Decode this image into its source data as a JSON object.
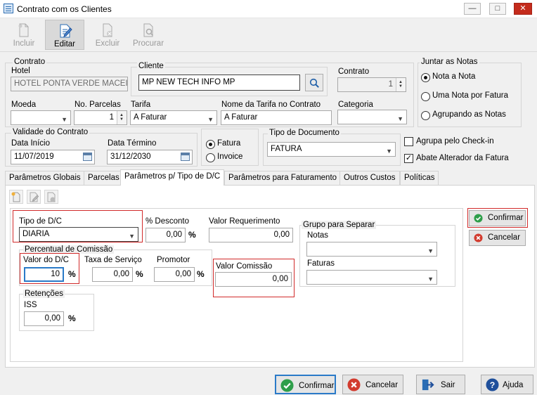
{
  "window": {
    "title": "Contrato com os Clientes",
    "minimize": "—",
    "maximize": "□",
    "close": "✕"
  },
  "toolbar": {
    "incluir": "Incluir",
    "editar": "Editar",
    "excluir": "Excluir",
    "procurar": "Procurar"
  },
  "contrato": {
    "legend": "Contrato",
    "hotel_label": "Hotel",
    "hotel_value": "HOTEL PONTA VERDE MACEIÓ",
    "cliente_legend": "Cliente",
    "cliente_value": "MP NEW TECH INFO MP",
    "contrato_label": "Contrato",
    "contrato_value": "1",
    "moeda_label": "Moeda",
    "moeda_value": "",
    "parcelas_label": "No. Parcelas",
    "parcelas_value": "1",
    "tarifa_label": "Tarifa",
    "tarifa_value": "A Faturar",
    "nome_tarifa_label": "Nome da Tarifa no Contrato",
    "nome_tarifa_value": "A Faturar",
    "categoria_label": "Categoria",
    "categoria_value": ""
  },
  "juntar": {
    "legend": "Juntar as Notas",
    "options": [
      "Nota a Nota",
      "Uma Nota por Fatura",
      "Agrupando as Notas"
    ],
    "selected": 0
  },
  "validade": {
    "legend": "Validade do Contrato",
    "inicio_label": "Data Início",
    "inicio_value": "11/07/2019",
    "termino_label": "Data Término",
    "termino_value": "31/12/2030"
  },
  "fatura_radio": {
    "fatura": "Fatura",
    "invoice": "Invoice",
    "selected": "fatura"
  },
  "tipo_documento": {
    "legend": "Tipo de Documento",
    "value": "FATURA"
  },
  "checks": {
    "agrupa_label": "Agrupa pelo Check-in",
    "agrupa_checked": false,
    "abate_label": "Abate Alterador da Fatura",
    "abate_checked": true,
    "check_mark": "✓"
  },
  "tabs": [
    {
      "label": "Parâmetros Globais"
    },
    {
      "label": "Parcelas"
    },
    {
      "label": "Parâmetros p/ Tipo de D/C"
    },
    {
      "label": "Parâmetros para Faturamento"
    },
    {
      "label": "Outros Custos"
    },
    {
      "label": "Políticas"
    }
  ],
  "selected_tab": 2,
  "dc": {
    "tipo_label": "Tipo de D/C",
    "tipo_value": "DIARIA",
    "desconto_label": "% Desconto",
    "desconto_value": "0,00",
    "valor_req_label": "Valor Requerimento",
    "valor_req_value": "0,00",
    "comissao_legend": "Percentual de Comissão",
    "valor_dc_label": "Valor do D/C",
    "valor_dc_value": "10",
    "taxa_label": "Taxa de Serviço",
    "taxa_value": "0,00",
    "promotor_label": "Promotor",
    "promotor_value": "0,00",
    "valor_comissao_label": "Valor Comissão",
    "valor_comissao_value": "0,00",
    "retencoes_legend": "Retenções",
    "iss_label": "ISS",
    "iss_value": "0,00",
    "pct": "%"
  },
  "grupo": {
    "legend": "Grupo para Separar",
    "notas_label": "Notas",
    "notas_value": "",
    "faturas_label": "Faturas",
    "faturas_value": ""
  },
  "side_buttons": {
    "confirmar": "Confirmar",
    "cancelar": "Cancelar"
  },
  "bottom_buttons": {
    "confirmar": "Confirmar",
    "cancelar": "Cancelar",
    "sair": "Sair",
    "ajuda": "Ajuda"
  },
  "colors": {
    "accent": "#2a7ac8",
    "confirm_green": "#2e9e4a",
    "cancel_red": "#d23b2e",
    "highlight_red": "#d12a2a",
    "help_blue": "#1f4f9b"
  }
}
